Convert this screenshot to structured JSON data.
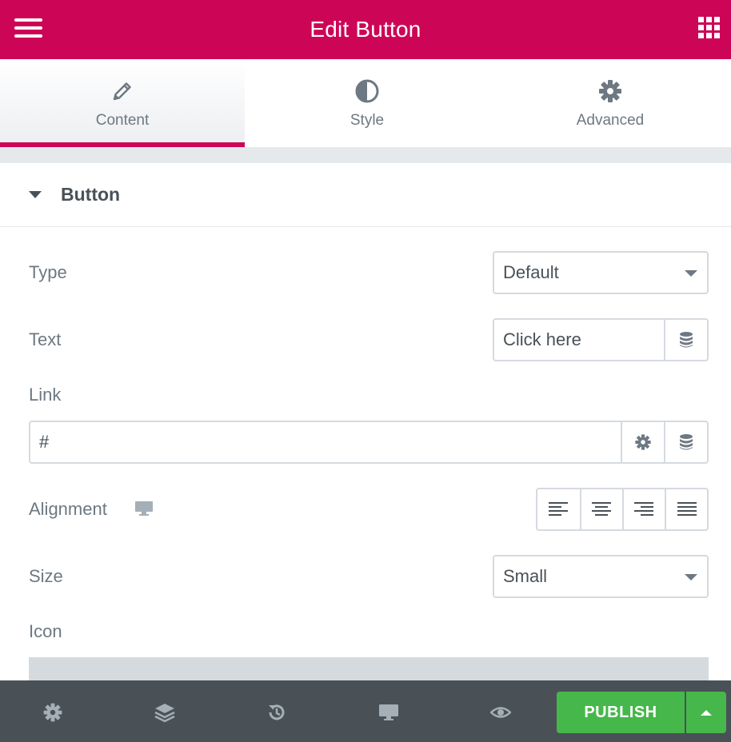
{
  "header": {
    "title": "Edit Button",
    "menu_icon": "hamburger-icon",
    "apps_icon": "grid-icon"
  },
  "tabs": [
    {
      "label": "Content",
      "icon": "pencil-icon",
      "active": true
    },
    {
      "label": "Style",
      "icon": "half-circle-icon",
      "active": false
    },
    {
      "label": "Advanced",
      "icon": "gear-icon",
      "active": false
    }
  ],
  "section": {
    "title": "Button"
  },
  "fields": {
    "type_label": "Type",
    "type_value": "Default",
    "text_label": "Text",
    "text_value": "Click here",
    "link_label": "Link",
    "link_value": "#",
    "alignment_label": "Alignment",
    "size_label": "Size",
    "size_value": "Small",
    "icon_label": "Icon"
  },
  "footer": {
    "publish_label": "PUBLISH",
    "icons": [
      "gear-icon",
      "layers-icon",
      "history-icon",
      "desktop-icon",
      "eye-icon"
    ]
  },
  "colors": {
    "brand": "#cd0556",
    "publish": "#46b74a",
    "footer_bg": "#495157"
  }
}
